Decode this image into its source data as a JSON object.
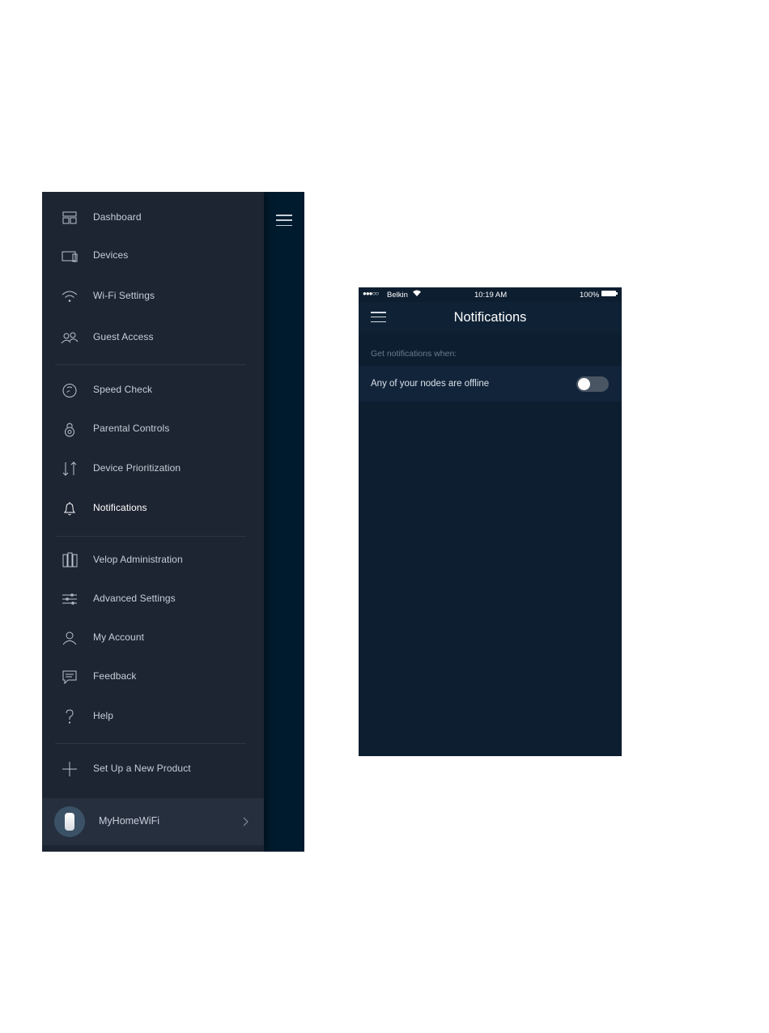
{
  "side_menu": {
    "items": [
      {
        "label": "Dashboard",
        "icon": "dashboard-icon"
      },
      {
        "label": "Devices",
        "icon": "devices-icon"
      },
      {
        "label": "Wi-Fi Settings",
        "icon": "wifi-icon"
      },
      {
        "label": "Guest Access",
        "icon": "guest-access-icon"
      },
      {
        "label": "Speed Check",
        "icon": "speedometer-icon"
      },
      {
        "label": "Parental Controls",
        "icon": "lock-icon"
      },
      {
        "label": "Device Prioritization",
        "icon": "priority-arrows-icon"
      },
      {
        "label": "Notifications",
        "icon": "bell-icon",
        "active": true
      },
      {
        "label": "Velop Administration",
        "icon": "velop-nodes-icon"
      },
      {
        "label": "Advanced Settings",
        "icon": "sliders-icon"
      },
      {
        "label": "My Account",
        "icon": "user-icon"
      },
      {
        "label": "Feedback",
        "icon": "chat-bubble-icon"
      },
      {
        "label": "Help",
        "icon": "question-icon"
      },
      {
        "label": "Set Up a New Product",
        "icon": "plus-icon"
      }
    ],
    "network": {
      "name": "MyHomeWiFi"
    }
  },
  "notifications_screen": {
    "status_bar": {
      "signal": "●●●○○",
      "carrier": "Belkin",
      "time": "10:19 AM",
      "battery": "100%"
    },
    "title": "Notifications",
    "section_header": "Get notifications when:",
    "settings": [
      {
        "label": "Any of your nodes are offline",
        "enabled": false
      }
    ]
  },
  "colors": {
    "drawer_bg": "#1d2532",
    "screen_bg": "#0d1e30",
    "text": "#c6ced8"
  }
}
